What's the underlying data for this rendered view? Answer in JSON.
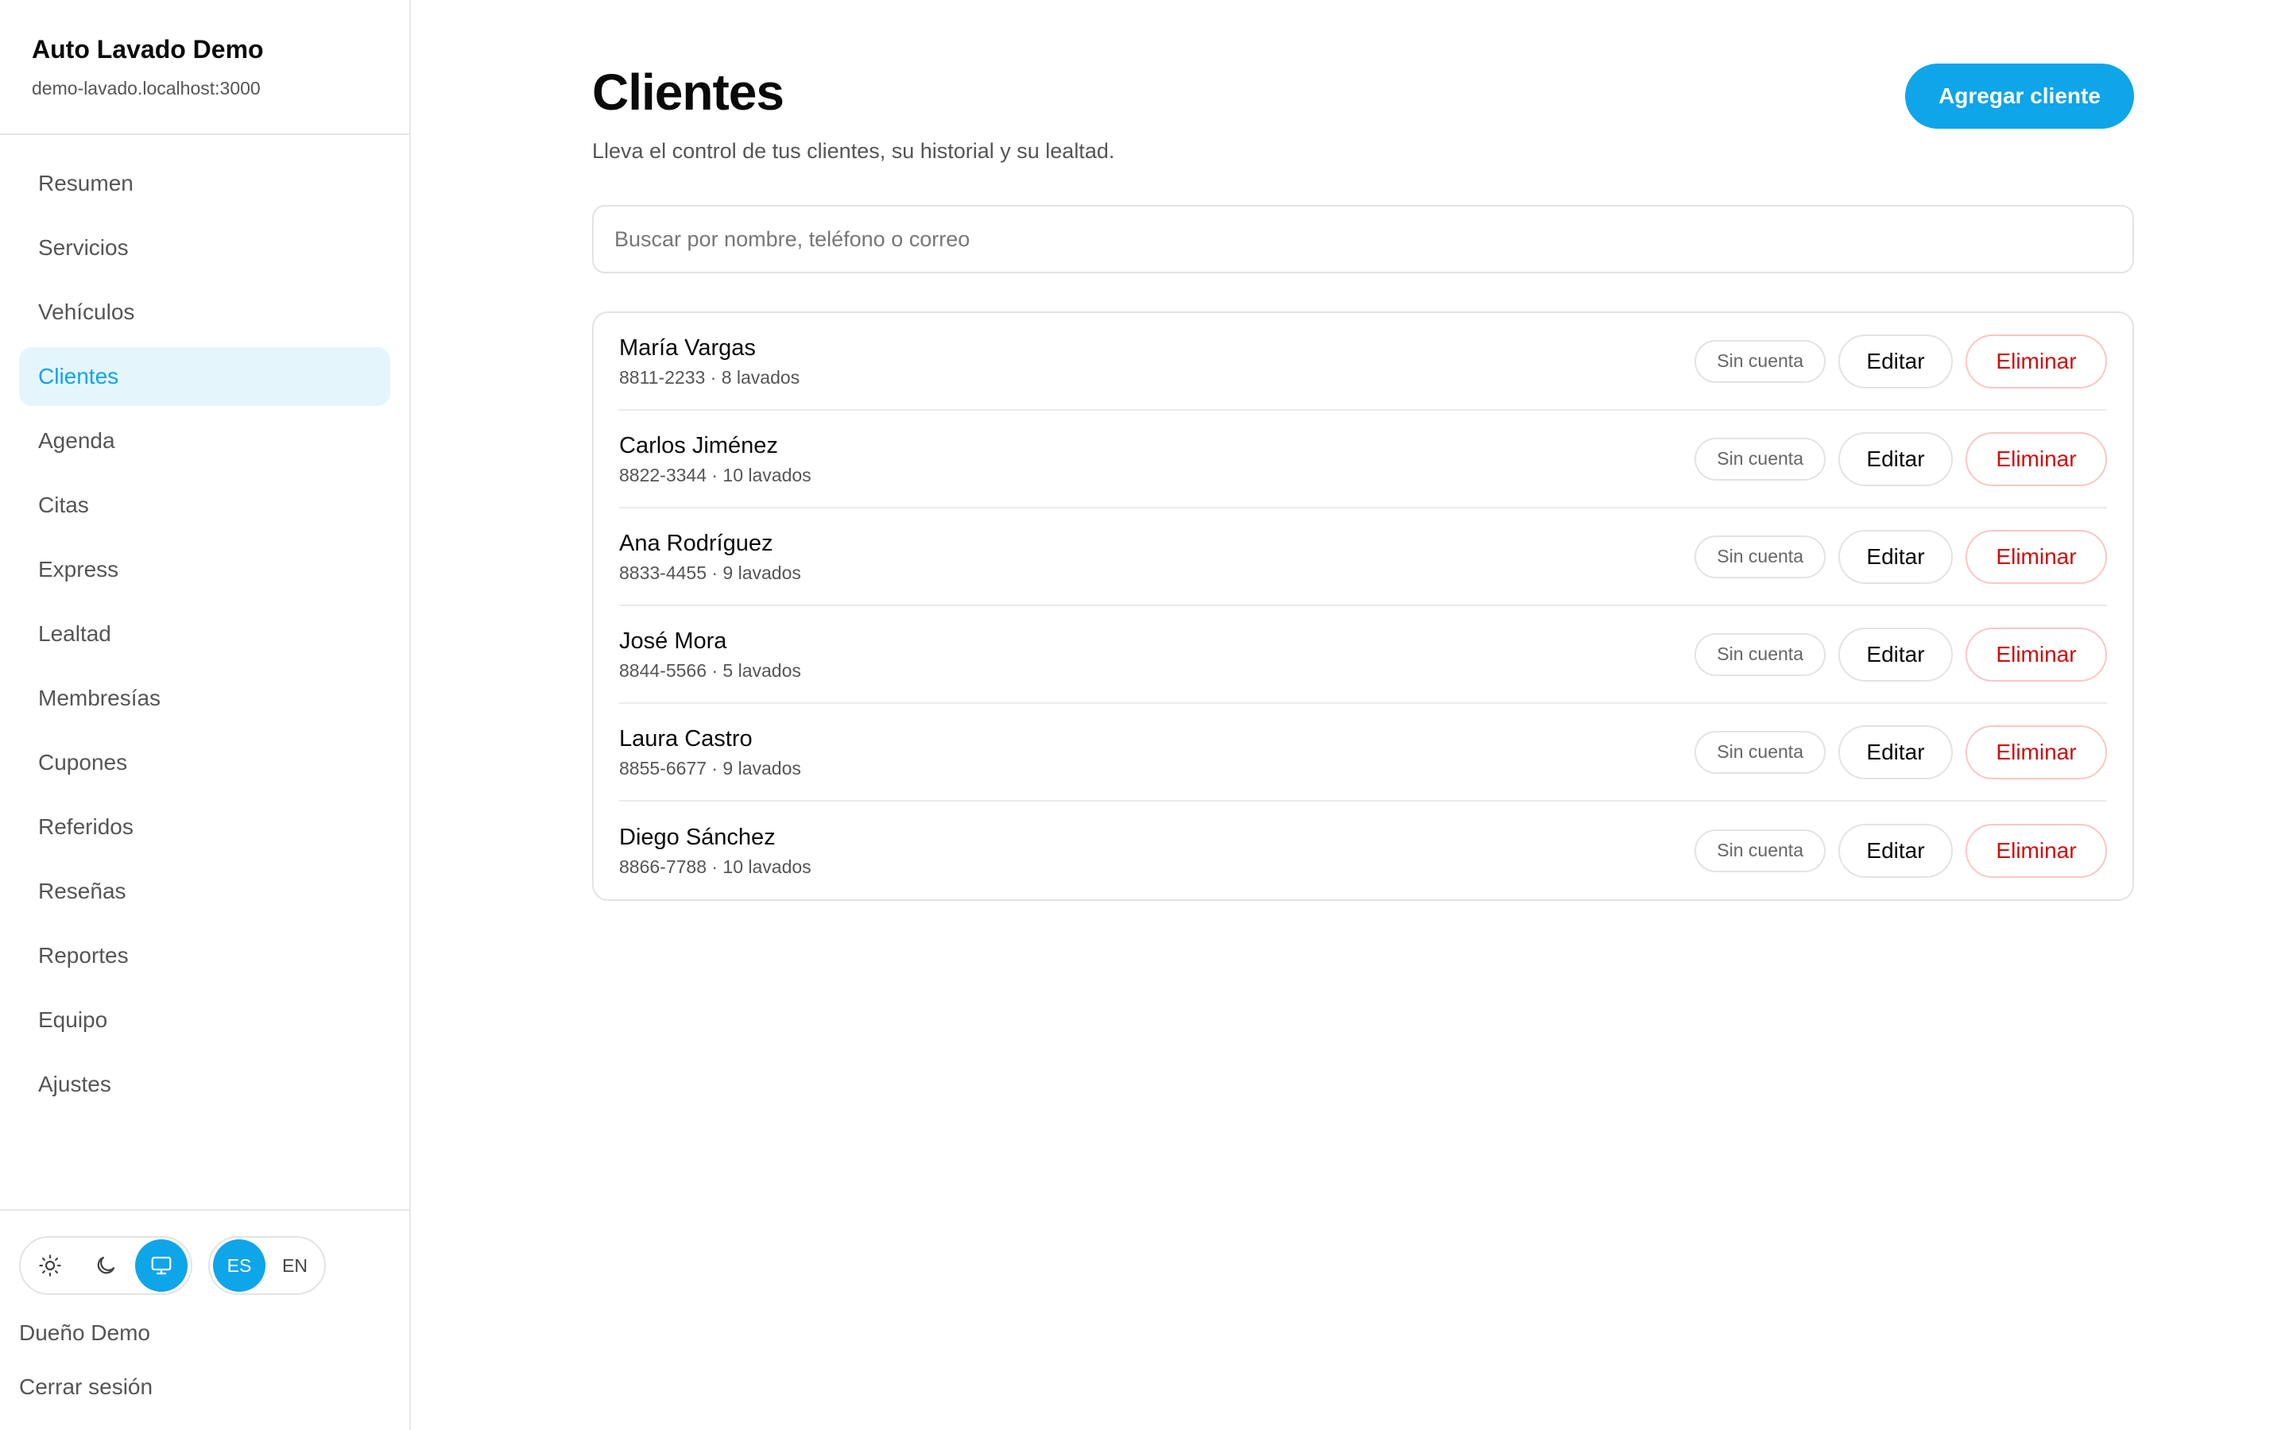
{
  "brand": {
    "title": "Auto Lavado Demo",
    "host": "demo-lavado.localhost:3000"
  },
  "sidebar": {
    "items": [
      {
        "label": "Resumen",
        "active": false
      },
      {
        "label": "Servicios",
        "active": false
      },
      {
        "label": "Vehículos",
        "active": false
      },
      {
        "label": "Clientes",
        "active": true
      },
      {
        "label": "Agenda",
        "active": false
      },
      {
        "label": "Citas",
        "active": false
      },
      {
        "label": "Express",
        "active": false
      },
      {
        "label": "Lealtad",
        "active": false
      },
      {
        "label": "Membresías",
        "active": false
      },
      {
        "label": "Cupones",
        "active": false
      },
      {
        "label": "Referidos",
        "active": false
      },
      {
        "label": "Reseñas",
        "active": false
      },
      {
        "label": "Reportes",
        "active": false
      },
      {
        "label": "Equipo",
        "active": false
      },
      {
        "label": "Ajustes",
        "active": false
      }
    ]
  },
  "footer": {
    "theme": {
      "options": [
        "sun-icon",
        "moon-icon",
        "monitor-icon"
      ],
      "selected": "monitor-icon"
    },
    "language": {
      "options": [
        "ES",
        "EN"
      ],
      "selected": "ES"
    },
    "user_name": "Dueño Demo",
    "logout_label": "Cerrar sesión"
  },
  "main": {
    "title": "Clientes",
    "subtitle": "Lleva el control de tus clientes, su historial y su lealtad.",
    "add_button_label": "Agregar cliente",
    "search_placeholder": "Buscar por nombre, teléfono o correo",
    "clients": [
      {
        "name": "María Vargas",
        "meta": "8811-2233 · 8 lavados",
        "badge": "Sin cuenta",
        "edit_label": "Editar",
        "delete_label": "Eliminar"
      },
      {
        "name": "Carlos Jiménez",
        "meta": "8822-3344 · 10 lavados",
        "badge": "Sin cuenta",
        "edit_label": "Editar",
        "delete_label": "Eliminar"
      },
      {
        "name": "Ana Rodríguez",
        "meta": "8833-4455 · 9 lavados",
        "badge": "Sin cuenta",
        "edit_label": "Editar",
        "delete_label": "Eliminar"
      },
      {
        "name": "José Mora",
        "meta": "8844-5566 · 5 lavados",
        "badge": "Sin cuenta",
        "edit_label": "Editar",
        "delete_label": "Eliminar"
      },
      {
        "name": "Laura Castro",
        "meta": "8855-6677 · 9 lavados",
        "badge": "Sin cuenta",
        "edit_label": "Editar",
        "delete_label": "Eliminar"
      },
      {
        "name": "Diego Sánchez",
        "meta": "8866-7788 · 10 lavados",
        "badge": "Sin cuenta",
        "edit_label": "Editar",
        "delete_label": "Eliminar"
      }
    ]
  },
  "colors": {
    "accent": "#0ea5e9",
    "active_bg": "#e5f5fc",
    "danger": "#d00d0d",
    "danger_border": "#fbc6c6"
  }
}
